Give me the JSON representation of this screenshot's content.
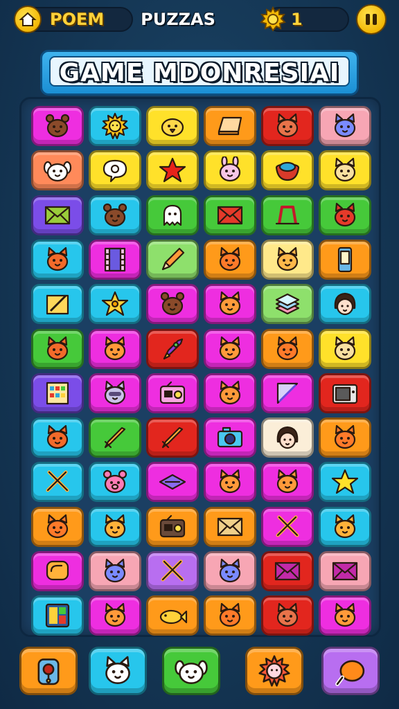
{
  "hud": {
    "left_label": "POEM",
    "center_label": "PUZZAS",
    "coin_count": "1",
    "left_icon": "home-badge-icon",
    "right_icon": "gear-coin-icon",
    "pause_icon": "pause-icon"
  },
  "title": "GAME MDONRESIAI",
  "colors": {
    "magenta": "#ee2ee0",
    "cyan": "#27c6ec",
    "yellow": "#ffe12a",
    "orange": "#ff9a1a",
    "red": "#e2261e",
    "pink": "#f7a6b4",
    "salmon": "#ff8a5a",
    "purple": "#7b4de8",
    "green": "#46c93a",
    "lightyellow": "#ffe98a",
    "lightgreen": "#8ee06c",
    "cream": "#fbeed8",
    "lilac": "#b86ef0"
  },
  "board": {
    "rows": [
      [
        {
          "c": "magenta",
          "i": "bear-face-icon"
        },
        {
          "c": "cyan",
          "i": "sun-face-icon"
        },
        {
          "c": "yellow",
          "i": "chick-face-icon"
        },
        {
          "c": "orange",
          "i": "book-icon"
        },
        {
          "c": "red",
          "i": "cat-face-icon"
        },
        {
          "c": "pink",
          "i": "cat-face-icon"
        }
      ],
      [
        {
          "c": "salmon",
          "i": "dog-face-icon"
        },
        {
          "c": "yellow",
          "i": "speech-bubble-icon"
        },
        {
          "c": "yellow",
          "i": "star-icon"
        },
        {
          "c": "yellow",
          "i": "bunny-face-icon"
        },
        {
          "c": "yellow",
          "i": "bowl-icon"
        },
        {
          "c": "yellow",
          "i": "cat-face-icon"
        }
      ],
      [
        {
          "c": "purple",
          "i": "envelope-icon"
        },
        {
          "c": "cyan",
          "i": "bear-face-icon"
        },
        {
          "c": "green",
          "i": "ghost-icon"
        },
        {
          "c": "green",
          "i": "envelope-icon"
        },
        {
          "c": "green",
          "i": "gate-icon"
        },
        {
          "c": "green",
          "i": "cat-face-icon"
        }
      ],
      [
        {
          "c": "cyan",
          "i": "fox-face-icon"
        },
        {
          "c": "magenta",
          "i": "film-icon"
        },
        {
          "c": "lightgreen",
          "i": "pencil-icon"
        },
        {
          "c": "orange",
          "i": "cat-face-icon"
        },
        {
          "c": "lightyellow",
          "i": "cat-face-icon"
        },
        {
          "c": "orange",
          "i": "phone-icon"
        }
      ],
      [
        {
          "c": "cyan",
          "i": "notepad-icon"
        },
        {
          "c": "cyan",
          "i": "star-badge-icon"
        },
        {
          "c": "magenta",
          "i": "bear-face-icon"
        },
        {
          "c": "magenta",
          "i": "cat-face-icon"
        },
        {
          "c": "lightgreen",
          "i": "stack-icon"
        },
        {
          "c": "cyan",
          "i": "girl-face-icon"
        }
      ],
      [
        {
          "c": "green",
          "i": "fox-face-icon"
        },
        {
          "c": "magenta",
          "i": "cat-face-icon"
        },
        {
          "c": "red",
          "i": "rocket-icon"
        },
        {
          "c": "magenta",
          "i": "cat-face-icon"
        },
        {
          "c": "orange",
          "i": "cat-face-icon"
        },
        {
          "c": "yellow",
          "i": "cat-face-icon"
        }
      ],
      [
        {
          "c": "purple",
          "i": "calendar-icon"
        },
        {
          "c": "magenta",
          "i": "raccoon-face-icon"
        },
        {
          "c": "magenta",
          "i": "radio-icon"
        },
        {
          "c": "magenta",
          "i": "cat-face-icon"
        },
        {
          "c": "magenta",
          "i": "ruler-icon"
        },
        {
          "c": "red",
          "i": "tv-icon"
        }
      ],
      [
        {
          "c": "cyan",
          "i": "fox-face-icon"
        },
        {
          "c": "green",
          "i": "sword-icon"
        },
        {
          "c": "red",
          "i": "sword-icon"
        },
        {
          "c": "magenta",
          "i": "camera-icon"
        },
        {
          "c": "cream",
          "i": "girl-face-icon"
        },
        {
          "c": "orange",
          "i": "cat-face-icon"
        }
      ],
      [
        {
          "c": "cyan",
          "i": "crossed-swords-icon"
        },
        {
          "c": "cyan",
          "i": "pig-face-icon"
        },
        {
          "c": "magenta",
          "i": "bird-icon"
        },
        {
          "c": "magenta",
          "i": "cat-face-icon"
        },
        {
          "c": "magenta",
          "i": "cat-face-icon"
        },
        {
          "c": "cyan",
          "i": "star-icon"
        }
      ],
      [
        {
          "c": "orange",
          "i": "cat-face-icon"
        },
        {
          "c": "cyan",
          "i": "cat-face-icon"
        },
        {
          "c": "orange",
          "i": "radio-icon"
        },
        {
          "c": "orange",
          "i": "envelope-icon"
        },
        {
          "c": "magenta",
          "i": "crossed-swords-icon"
        },
        {
          "c": "cyan",
          "i": "cat-face-icon"
        }
      ],
      [
        {
          "c": "magenta",
          "i": "chat-icon"
        },
        {
          "c": "pink",
          "i": "cat-face-icon"
        },
        {
          "c": "lilac",
          "i": "crossed-swords-icon"
        },
        {
          "c": "pink",
          "i": "cat-face-icon"
        },
        {
          "c": "red",
          "i": "envelope-icon"
        },
        {
          "c": "pink",
          "i": "envelope-icon"
        }
      ],
      [
        {
          "c": "cyan",
          "i": "tablet-icon"
        },
        {
          "c": "magenta",
          "i": "cat-face-icon"
        },
        {
          "c": "orange",
          "i": "fish-icon"
        },
        {
          "c": "orange",
          "i": "cat-face-icon"
        },
        {
          "c": "red",
          "i": "cat-face-icon"
        },
        {
          "c": "magenta",
          "i": "cat-face-icon"
        }
      ]
    ]
  },
  "tray": [
    {
      "c": "orange",
      "i": "robot-icon"
    },
    {
      "c": "cyan",
      "i": "cat-face-icon"
    },
    {
      "c": "green",
      "i": "dog-face-icon"
    },
    {
      "c": "orange",
      "i": "sun-face-icon"
    },
    {
      "c": "lilac",
      "i": "meat-icon"
    }
  ]
}
